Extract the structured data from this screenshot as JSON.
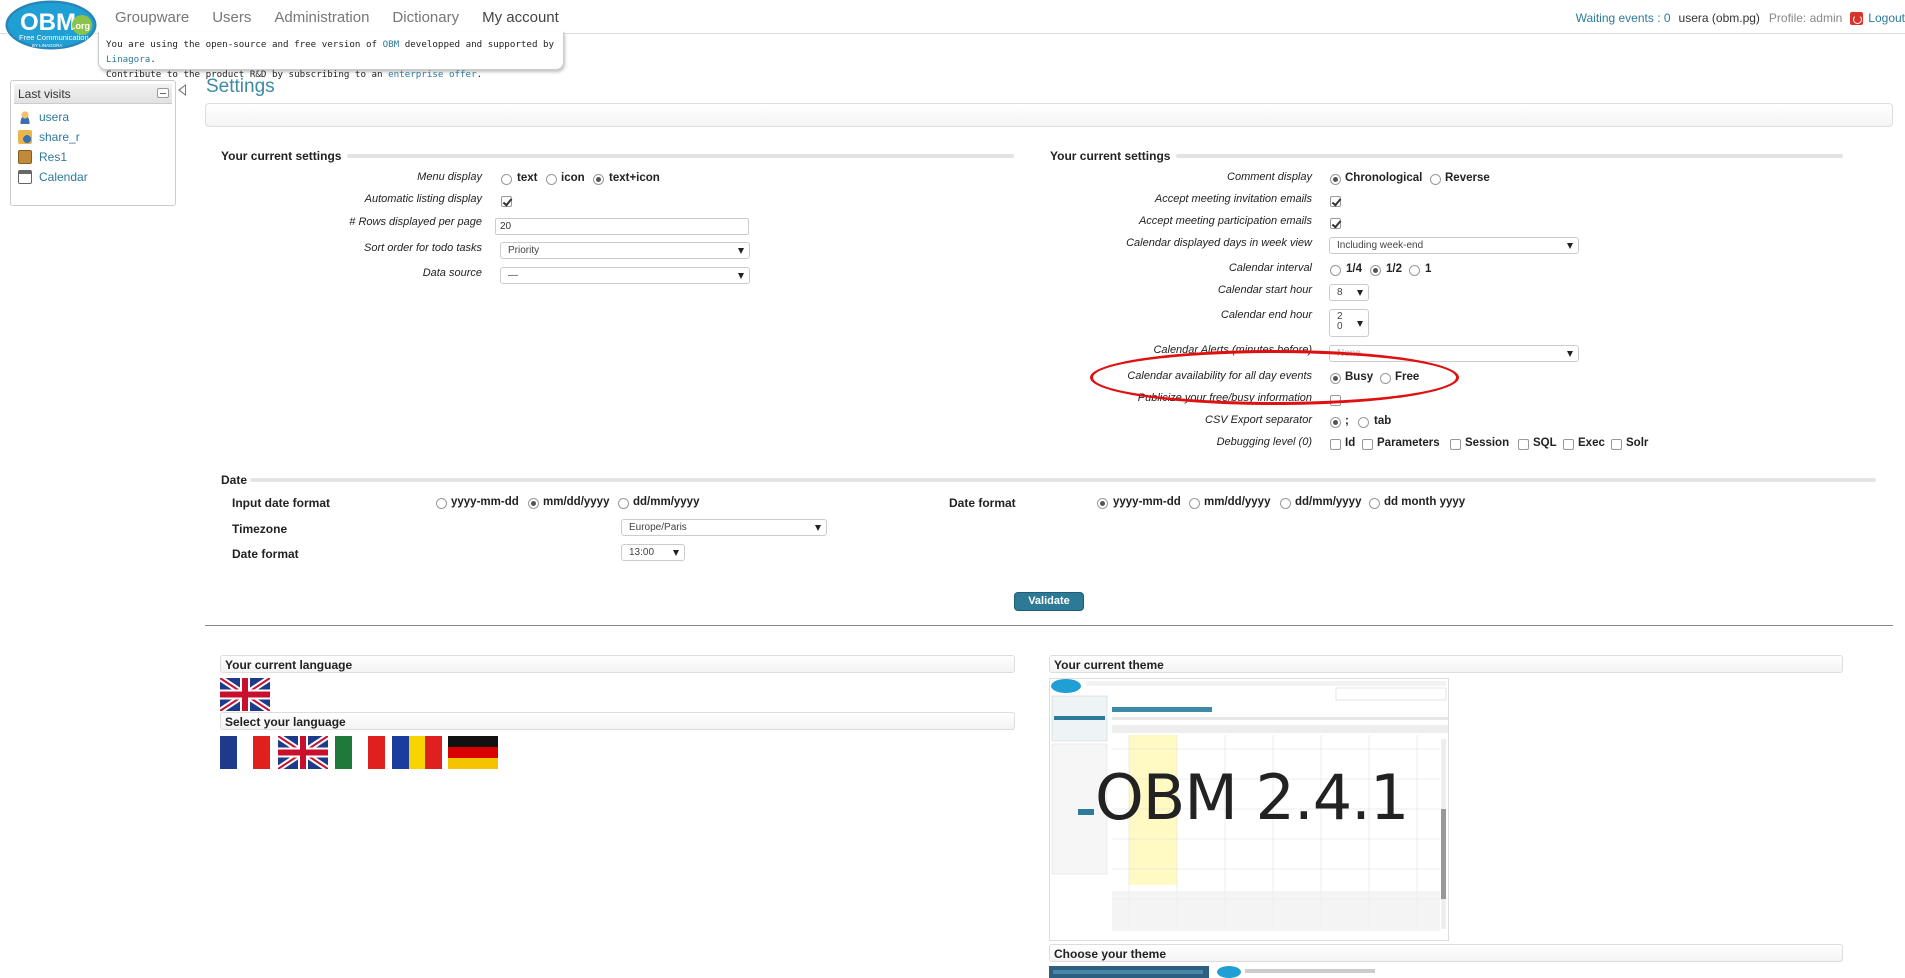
{
  "logo": {
    "text": "OBM",
    "tld": ".org",
    "sub": "Free Communication",
    "by": "BY LINAGORA"
  },
  "nav": [
    "Groupware",
    "Users",
    "Administration",
    "Dictionary",
    "My account"
  ],
  "topright": {
    "waiting": "Waiting events : 0",
    "user": "usera (obm.pg)",
    "profile": "Profile: admin",
    "logout": "Logout"
  },
  "banner": {
    "line1_a": "You are using the open-source and free version of ",
    "line1_obm": "OBM",
    "line1_b": " developped and supported by ",
    "line1_lin": "Linagora",
    "line1_c": ".",
    "line2_a": "Contribute to the product R&D by subscribing to an ",
    "line2_ent": "enterprise offer",
    "line2_b": "."
  },
  "sidebar": {
    "title": "Last visits",
    "items": [
      "usera",
      "share_r",
      "Res1",
      "Calendar"
    ]
  },
  "page": {
    "title": "Settings"
  },
  "left_settings": {
    "section_title": "Your current settings",
    "menu_display_label": "Menu display",
    "menu_options": [
      "text",
      "icon",
      "text+icon"
    ],
    "auto_listing_label": "Automatic listing display",
    "rows_label": "# Rows displayed per page",
    "rows_value": "20",
    "sort_label": "Sort order for todo tasks",
    "sort_value": "Priority",
    "datasource_label": "Data source",
    "datasource_value": "—"
  },
  "right_settings": {
    "section_title": "Your current settings",
    "comment_label": "Comment display",
    "comment_options": [
      "Chronological",
      "Reverse"
    ],
    "accept_inv_label": "Accept meeting invitation emails",
    "accept_part_label": "Accept meeting participation emails",
    "days_label": "Calendar displayed days in week view",
    "days_value": "Including week-end",
    "interval_label": "Calendar interval",
    "interval_options": [
      "1/4",
      "1/2",
      "1"
    ],
    "start_label": "Calendar start hour",
    "start_value": "8",
    "end_label": "Calendar end hour",
    "end_value_1": "2",
    "end_value_2": "0",
    "alerts_label": "Calendar Alerts (minutes before)",
    "alerts_value": "None",
    "avail_label": "Calendar availability for all day events",
    "avail_options": [
      "Busy",
      "Free"
    ],
    "publicize_label": "Publicize your free/busy information",
    "csv_label": "CSV Export separator",
    "csv_options": [
      ";",
      "tab"
    ],
    "debug_label": "Debugging level (0)",
    "debug_options": [
      "Id",
      "Parameters",
      "Session",
      "SQL",
      "Exec",
      "Solr"
    ]
  },
  "date": {
    "section_title": "Date",
    "input_label": "Input date format",
    "input_options": [
      "yyyy-mm-dd",
      "mm/dd/yyyy",
      "dd/mm/yyyy"
    ],
    "tz_label": "Timezone",
    "tz_value": "Europe/Paris",
    "format_label": "Date format",
    "format_value": "13:00",
    "date_format_label": "Date format",
    "date_format_options": [
      "yyyy-mm-dd",
      "mm/dd/yyyy",
      "dd/mm/yyyy",
      "dd month yyyy"
    ]
  },
  "validate_label": "Validate",
  "language": {
    "current_title": "Your current language",
    "select_title": "Select your language"
  },
  "theme": {
    "current_title": "Your current theme",
    "choose_title": "Choose your theme",
    "version": "OBM 2.4.1"
  },
  "colors": {
    "accent": "#2d7a9a",
    "highlight": "#e01010"
  }
}
